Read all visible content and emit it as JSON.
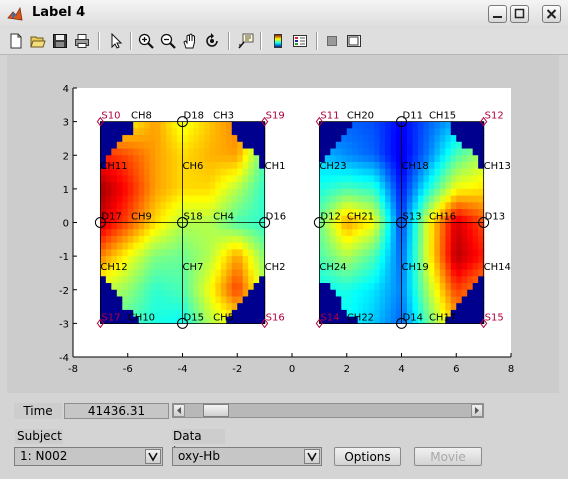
{
  "window": {
    "title": "Label 4"
  },
  "toolbar": {
    "icons": [
      "new-file-icon",
      "open-folder-icon",
      "save-icon",
      "print-icon",
      "pointer-icon",
      "zoom-in-icon",
      "zoom-out-icon",
      "pan-hand-icon",
      "rotate-3d-icon",
      "data-cursor-icon",
      "colorbar-icon",
      "legend-icon",
      "hide-tools-icon",
      "show-tools-icon"
    ]
  },
  "axes": {
    "x_ticks": [
      "-8",
      "-6",
      "-4",
      "-2",
      "0",
      "2",
      "4",
      "6",
      "8"
    ],
    "y_ticks": [
      "4",
      "3",
      "2",
      "1",
      "0",
      "-1",
      "-2",
      "-3",
      "-4"
    ],
    "x_range": [
      -8,
      8
    ],
    "y_range": [
      -4,
      4
    ]
  },
  "maps": [
    {
      "center_x": -4,
      "sources": [
        {
          "label": "S10",
          "x": -7,
          "y": 3
        },
        {
          "label": "S19",
          "x": -1,
          "y": 3
        },
        {
          "label": "S17",
          "x": -7,
          "y": -3
        },
        {
          "label": "S16",
          "x": -1,
          "y": -3
        }
      ],
      "detectors": [
        {
          "label": "D18",
          "x": -4,
          "y": 3
        },
        {
          "label": "D17",
          "x": -7,
          "y": 0
        },
        {
          "label": "S18",
          "x": -4,
          "y": 0
        },
        {
          "label": "D16",
          "x": -1,
          "y": 0
        },
        {
          "label": "D15",
          "x": -4,
          "y": -3
        }
      ],
      "channels": [
        {
          "label": "CH8",
          "x": -5.5,
          "y": 3
        },
        {
          "label": "CH3",
          "x": -2.5,
          "y": 3
        },
        {
          "label": "CH11",
          "x": -7,
          "y": 1.5
        },
        {
          "label": "CH6",
          "x": -4,
          "y": 1.5
        },
        {
          "label": "CH1",
          "x": -1,
          "y": 1.5
        },
        {
          "label": "CH9",
          "x": -5.5,
          "y": 0
        },
        {
          "label": "CH4",
          "x": -2.5,
          "y": 0
        },
        {
          "label": "CH12",
          "x": -7,
          "y": -1.5
        },
        {
          "label": "CH7",
          "x": -4,
          "y": -1.5
        },
        {
          "label": "CH2",
          "x": -1,
          "y": -1.5
        },
        {
          "label": "CH10",
          "x": -5.5,
          "y": -3
        },
        {
          "label": "CH5",
          "x": -2.5,
          "y": -3
        }
      ],
      "values": [
        [
          0.55,
          0.62,
          0.72,
          0.6,
          0.68,
          0.75,
          0.55
        ],
        [
          0.85,
          0.8,
          0.72,
          0.66,
          0.7,
          0.72,
          0.45
        ],
        [
          0.97,
          0.86,
          0.72,
          0.66,
          0.66,
          0.55,
          0.42
        ],
        [
          0.92,
          0.8,
          0.66,
          0.55,
          0.55,
          0.45,
          0.42
        ],
        [
          0.75,
          0.62,
          0.5,
          0.48,
          0.55,
          0.72,
          0.5
        ],
        [
          0.58,
          0.52,
          0.42,
          0.45,
          0.62,
          0.82,
          0.55
        ],
        [
          0.5,
          0.45,
          0.4,
          0.38,
          0.55,
          0.62,
          0.45
        ]
      ]
    },
    {
      "center_x": 4,
      "sources": [
        {
          "label": "S11",
          "x": 1,
          "y": 3
        },
        {
          "label": "S12",
          "x": 7,
          "y": 3
        },
        {
          "label": "S14",
          "x": 1,
          "y": -3
        },
        {
          "label": "S15",
          "x": 7,
          "y": -3
        }
      ],
      "detectors": [
        {
          "label": "D11",
          "x": 4,
          "y": 3
        },
        {
          "label": "D12",
          "x": 1,
          "y": 0
        },
        {
          "label": "S13",
          "x": 4,
          "y": 0
        },
        {
          "label": "D13",
          "x": 7,
          "y": 0
        },
        {
          "label": "D14",
          "x": 4,
          "y": -3
        }
      ],
      "channels": [
        {
          "label": "CH20",
          "x": 2.5,
          "y": 3
        },
        {
          "label": "CH15",
          "x": 5.5,
          "y": 3
        },
        {
          "label": "CH23",
          "x": 1,
          "y": 1.5
        },
        {
          "label": "CH18",
          "x": 4,
          "y": 1.5
        },
        {
          "label": "CH13",
          "x": 7,
          "y": 1.5
        },
        {
          "label": "CH21",
          "x": 2.5,
          "y": 0
        },
        {
          "label": "CH16",
          "x": 5.5,
          "y": 0
        },
        {
          "label": "CH24",
          "x": 1,
          "y": -1.5
        },
        {
          "label": "CH19",
          "x": 4,
          "y": -1.5
        },
        {
          "label": "CH14",
          "x": 7,
          "y": -1.5
        },
        {
          "label": "CH22",
          "x": 2.5,
          "y": -3
        },
        {
          "label": "CH17",
          "x": 5.5,
          "y": -3
        }
      ],
      "values": [
        [
          0.18,
          0.22,
          0.2,
          0.12,
          0.22,
          0.3,
          0.35
        ],
        [
          0.32,
          0.26,
          0.22,
          0.1,
          0.25,
          0.45,
          0.55
        ],
        [
          0.4,
          0.45,
          0.42,
          0.14,
          0.4,
          0.62,
          0.65
        ],
        [
          0.48,
          0.72,
          0.62,
          0.18,
          0.62,
          0.92,
          0.8
        ],
        [
          0.45,
          0.55,
          0.45,
          0.22,
          0.62,
          0.95,
          0.85
        ],
        [
          0.38,
          0.4,
          0.35,
          0.25,
          0.55,
          0.82,
          0.72
        ],
        [
          0.35,
          0.38,
          0.32,
          0.22,
          0.48,
          0.7,
          0.65
        ]
      ]
    }
  ],
  "controls": {
    "time_label": "Time",
    "time_value": "41436.31",
    "slider_position": 0.06,
    "subject_label": "Subject",
    "subject_value": "1: N002",
    "datatype_label": "Data type",
    "datatype_value": "oxy-Hb",
    "options_button": "Options",
    "movie_button": "Movie"
  },
  "colors": {
    "marker_source": "#b0003a",
    "marker_detector": "#000000",
    "background": "#d4d4d4"
  }
}
